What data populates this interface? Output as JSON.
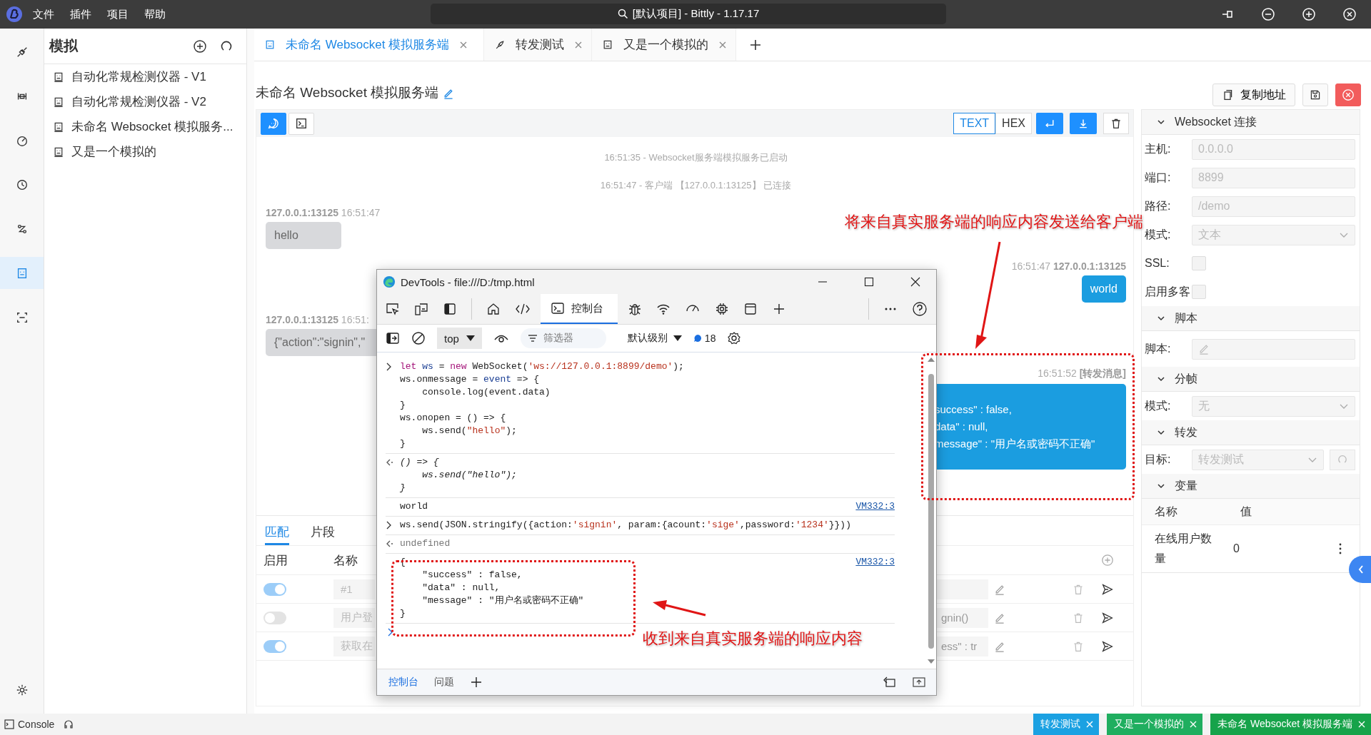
{
  "menu": [
    "文件",
    "插件",
    "项目",
    "帮助"
  ],
  "window_title": "[默认项目] - Bittly - 1.17.17",
  "rail": [
    {
      "selected": false
    },
    {
      "selected": false
    },
    {
      "selected": false
    },
    {
      "selected": false
    },
    {
      "selected": false
    },
    {
      "selected": true
    },
    {
      "selected": false
    }
  ],
  "sidebar": {
    "title": "模拟",
    "items": [
      "自动化常规检测仪器 - V1",
      "自动化常规检测仪器 - V2",
      "未命名 Websocket 模拟服务...",
      "又是一个模拟的"
    ]
  },
  "tabs": [
    {
      "label": "未命名 Websocket 模拟服务端",
      "selected": true
    },
    {
      "label": "转发测试",
      "selected": false
    },
    {
      "label": "又是一个模拟的",
      "selected": false
    }
  ],
  "page_title": "未命名 Websocket 模拟服务端",
  "copy_button": "复制地址",
  "view_modes": [
    {
      "selected": true
    },
    {
      "selected": false
    }
  ],
  "formats": [
    {
      "label": "TEXT",
      "selected": true
    },
    {
      "label": "HEX",
      "selected": false
    }
  ],
  "messages": [
    {
      "kind": "system",
      "text": "16:51:35 - Websocket服务端模拟服务已启动"
    },
    {
      "kind": "system",
      "text": "16:51:47 - 客户端 【127.0.0.1:13125】 已连接"
    },
    {
      "kind": "received",
      "source": "127.0.0.1:13125",
      "time": "16:51:47",
      "lines": [
        "hello"
      ]
    },
    {
      "kind": "sent",
      "time": "16:51:47",
      "source": "127.0.0.1:13125",
      "lines": [
        "world"
      ]
    },
    {
      "kind": "received",
      "source": "127.0.0.1:13125",
      "time": "16:51:",
      "lines": [
        "{\"action\":\"signin\",\""
      ]
    },
    {
      "kind": "sent",
      "time": "16:51:52",
      "source": "[转发消息]",
      "lines": [
        "success\" : false,",
        "data\" : null,",
        "message\" : \"用户名或密码不正确\""
      ]
    }
  ],
  "bottom_panel": {
    "tabs": [
      {
        "label": "匹配",
        "selected": true
      },
      {
        "label": "片段",
        "selected": false
      }
    ],
    "columns": [
      "启用",
      "名称"
    ],
    "rows": [
      {
        "enabled": true,
        "name": "#1"
      },
      {
        "enabled": false,
        "name": "用户登",
        "column_3": "gnin()"
      },
      {
        "enabled": true,
        "name": "获取在",
        "column_3": "ess\" : tr"
      }
    ]
  },
  "right_panel": [
    {
      "title": "Websocket 连接",
      "expanded": true,
      "fields": [
        {
          "kind": "input",
          "label": "主机:",
          "value": "0.0.0.0"
        },
        {
          "kind": "input",
          "label": "端口:",
          "value": "8899"
        },
        {
          "kind": "input",
          "label": "路径:",
          "value": "/demo"
        },
        {
          "kind": "select",
          "label": "模式:",
          "value": "文本"
        },
        {
          "kind": "checkbox",
          "label": "SSL:",
          "checked": false
        },
        {
          "kind": "checkbox",
          "label": "启用多客",
          "checked": false
        }
      ]
    },
    {
      "title": "脚本",
      "expanded": true,
      "fields": [
        {
          "kind": "script",
          "label": "脚本:"
        }
      ]
    },
    {
      "title": "分帧",
      "expanded": true,
      "fields": [
        {
          "kind": "select",
          "label": "模式:",
          "value": "无"
        }
      ]
    },
    {
      "title": "转发",
      "expanded": true,
      "fields": [
        {
          "kind": "select_refresh",
          "label": "目标:",
          "value": "转发测试"
        }
      ]
    },
    {
      "title": "变量",
      "expanded": true,
      "table": {
        "columns": [
          "名称",
          "值"
        ],
        "rows": [
          {
            "name": "在线用户数量",
            "value": "0"
          }
        ]
      }
    }
  ],
  "devtools": {
    "title": "DevTools - file:///D:/tmp.html",
    "tab": {
      "label": "控制台",
      "selected": true
    },
    "context": "top",
    "filter_placeholder": "筛选器",
    "level": "默认级别",
    "message_count": "18",
    "console": [
      {
        "kind": "input",
        "lines": [
          [
            {
              "text": "let ",
              "color": "#a5157a"
            },
            {
              "text": "ws",
              "color": "#1b3f94"
            },
            {
              "text": " = ",
              "color": "#222222"
            },
            {
              "text": "new",
              "color": "#a5157a"
            },
            {
              "text": " WebSocket(",
              "color": "#222222"
            },
            {
              "text": "'ws://127.0.0.1:8899/demo'",
              "color": "#b8311c"
            },
            {
              "text": ");",
              "color": "#222222"
            }
          ],
          [
            {
              "text": "ws.onmessage = ",
              "color": "#222222"
            },
            {
              "text": "event",
              "color": "#1b3f94"
            },
            {
              "text": " => {",
              "color": "#222222"
            }
          ],
          [
            {
              "text": "    console.log(event.data)",
              "color": "#222222"
            }
          ],
          [
            {
              "text": "}",
              "color": "#222222"
            }
          ],
          [
            {
              "text": "ws.onopen = () => {",
              "color": "#222222"
            }
          ],
          [
            {
              "text": "    ws.send(",
              "color": "#222222"
            },
            {
              "text": "\"hello\"",
              "color": "#b8311c"
            },
            {
              "text": ");",
              "color": "#222222"
            }
          ],
          [
            {
              "text": "}",
              "color": "#222222"
            }
          ]
        ]
      },
      {
        "kind": "result",
        "lines": [
          "() => {",
          "    ws.send(\"hello\");",
          "}"
        ]
      },
      {
        "kind": "log",
        "lines": [
          "world"
        ],
        "source": "VM332:3"
      },
      {
        "kind": "input",
        "lines": [
          [
            {
              "text": "ws.send(JSON.stringify({action:",
              "color": "#222222"
            },
            {
              "text": "'signin'",
              "color": "#b8311c"
            },
            {
              "text": ", param:{acount:",
              "color": "#222222"
            },
            {
              "text": "'sige'",
              "color": "#b8311c"
            },
            {
              "text": ",password:",
              "color": "#222222"
            },
            {
              "text": "'1234'",
              "color": "#b8311c"
            },
            {
              "text": "}}))",
              "color": "#222222"
            }
          ]
        ]
      },
      {
        "kind": "void",
        "lines": [
          "undefined"
        ]
      },
      {
        "kind": "log",
        "lines": [
          "{",
          "    \"success\" : false,",
          "    \"data\" : null,",
          "    \"message\" : \"用户名或密码不正确\"",
          "}"
        ],
        "source": "VM332:3"
      }
    ],
    "drawer_tabs": [
      {
        "label": "控制台",
        "selected": true
      },
      {
        "label": "问题",
        "selected": false
      }
    ]
  },
  "annotations": [
    "将来自真实服务端的响应内容发送给客户端",
    "收到来自真实服务端的响应内容"
  ],
  "status_bar": {
    "console": "Console",
    "tags": [
      {
        "label": "转发测试",
        "color": "#1ba1e2"
      },
      {
        "label": "又是一个模拟的",
        "color": "#1fae5f"
      },
      {
        "label": "未命名 Websocket 模拟服务端",
        "color": "#16a34a"
      }
    ]
  }
}
